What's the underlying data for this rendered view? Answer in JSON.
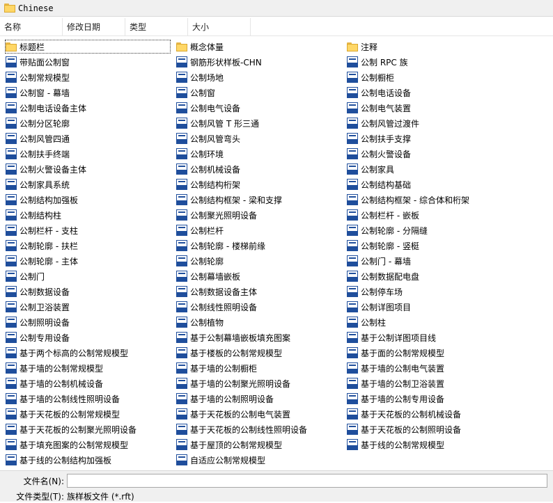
{
  "titlebar": {
    "path": "Chinese"
  },
  "columns": [
    "名称",
    "修改日期",
    "类型",
    "大小"
  ],
  "files": {
    "col1": [
      {
        "name": "标题栏",
        "type": "folder",
        "selected": true
      },
      {
        "name": "带贴面公制窗",
        "type": "rft"
      },
      {
        "name": "公制常规模型",
        "type": "rft"
      },
      {
        "name": "公制窗 - 幕墙",
        "type": "rft"
      },
      {
        "name": "公制电话设备主体",
        "type": "rft"
      },
      {
        "name": "公制分区轮廓",
        "type": "rft"
      },
      {
        "name": "公制风管四通",
        "type": "rft"
      },
      {
        "name": "公制扶手终端",
        "type": "rft"
      },
      {
        "name": "公制火警设备主体",
        "type": "rft"
      },
      {
        "name": "公制家具系统",
        "type": "rft"
      },
      {
        "name": "公制结构加强板",
        "type": "rft"
      },
      {
        "name": "公制结构柱",
        "type": "rft"
      },
      {
        "name": "公制栏杆 - 支柱",
        "type": "rft"
      },
      {
        "name": "公制轮廓 - 扶栏",
        "type": "rft"
      },
      {
        "name": "公制轮廓 - 主体",
        "type": "rft"
      },
      {
        "name": "公制门",
        "type": "rft"
      },
      {
        "name": "公制数据设备",
        "type": "rft"
      },
      {
        "name": "公制卫浴装置",
        "type": "rft"
      },
      {
        "name": "公制照明设备",
        "type": "rft"
      },
      {
        "name": "公制专用设备",
        "type": "rft"
      },
      {
        "name": "基于两个标高的公制常规模型",
        "type": "rft"
      },
      {
        "name": "基于墙的公制常规模型",
        "type": "rft"
      },
      {
        "name": "基于墙的公制机械设备",
        "type": "rft"
      },
      {
        "name": "基于墙的公制线性照明设备",
        "type": "rft"
      },
      {
        "name": "基于天花板的公制常规模型",
        "type": "rft"
      },
      {
        "name": "基于天花板的公制聚光照明设备",
        "type": "rft"
      },
      {
        "name": "基于填充图案的公制常规模型",
        "type": "rft"
      },
      {
        "name": "基于线的公制结构加强板",
        "type": "rft"
      }
    ],
    "col2": [
      {
        "name": "概念体量",
        "type": "folder"
      },
      {
        "name": "钢筋形状样板-CHN",
        "type": "rft"
      },
      {
        "name": "公制场地",
        "type": "rft"
      },
      {
        "name": "公制窗",
        "type": "rft"
      },
      {
        "name": "公制电气设备",
        "type": "rft"
      },
      {
        "name": "公制风管 T 形三通",
        "type": "rft"
      },
      {
        "name": "公制风管弯头",
        "type": "rft"
      },
      {
        "name": "公制环境",
        "type": "rft"
      },
      {
        "name": "公制机械设备",
        "type": "rft"
      },
      {
        "name": "公制结构桁架",
        "type": "rft"
      },
      {
        "name": "公制结构框架 - 梁和支撑",
        "type": "rft"
      },
      {
        "name": "公制聚光照明设备",
        "type": "rft"
      },
      {
        "name": "公制栏杆",
        "type": "rft"
      },
      {
        "name": "公制轮廓 - 楼梯前缘",
        "type": "rft"
      },
      {
        "name": "公制轮廓",
        "type": "rft"
      },
      {
        "name": "公制幕墙嵌板",
        "type": "rft"
      },
      {
        "name": "公制数据设备主体",
        "type": "rft"
      },
      {
        "name": "公制线性照明设备",
        "type": "rft"
      },
      {
        "name": "公制植物",
        "type": "rft"
      },
      {
        "name": "基于公制幕墙嵌板填充图案",
        "type": "rft"
      },
      {
        "name": "基于楼板的公制常规模型",
        "type": "rft"
      },
      {
        "name": "基于墙的公制橱柜",
        "type": "rft"
      },
      {
        "name": "基于墙的公制聚光照明设备",
        "type": "rft"
      },
      {
        "name": "基于墙的公制照明设备",
        "type": "rft"
      },
      {
        "name": "基于天花板的公制电气装置",
        "type": "rft"
      },
      {
        "name": "基于天花板的公制线性照明设备",
        "type": "rft"
      },
      {
        "name": "基于屋顶的公制常规模型",
        "type": "rft"
      },
      {
        "name": "自适应公制常规模型",
        "type": "rft"
      }
    ],
    "col3": [
      {
        "name": "注释",
        "type": "folder"
      },
      {
        "name": "公制 RPC 族",
        "type": "rft"
      },
      {
        "name": "公制橱柜",
        "type": "rft"
      },
      {
        "name": "公制电话设备",
        "type": "rft"
      },
      {
        "name": "公制电气装置",
        "type": "rft"
      },
      {
        "name": "公制风管过渡件",
        "type": "rft"
      },
      {
        "name": "公制扶手支撑",
        "type": "rft"
      },
      {
        "name": "公制火警设备",
        "type": "rft"
      },
      {
        "name": "公制家具",
        "type": "rft"
      },
      {
        "name": "公制结构基础",
        "type": "rft"
      },
      {
        "name": "公制结构框架 - 综合体和桁架",
        "type": "rft"
      },
      {
        "name": "公制栏杆 - 嵌板",
        "type": "rft"
      },
      {
        "name": "公制轮廓 - 分隔缝",
        "type": "rft"
      },
      {
        "name": "公制轮廓 - 竖梃",
        "type": "rft"
      },
      {
        "name": "公制门 - 幕墙",
        "type": "rft"
      },
      {
        "name": "公制数据配电盘",
        "type": "rft"
      },
      {
        "name": "公制停车场",
        "type": "rft"
      },
      {
        "name": "公制详图项目",
        "type": "rft"
      },
      {
        "name": "公制柱",
        "type": "rft"
      },
      {
        "name": "基于公制详图项目线",
        "type": "rft"
      },
      {
        "name": "基于面的公制常规模型",
        "type": "rft"
      },
      {
        "name": "基于墙的公制电气装置",
        "type": "rft"
      },
      {
        "name": "基于墙的公制卫浴装置",
        "type": "rft"
      },
      {
        "name": "基于墙的公制专用设备",
        "type": "rft"
      },
      {
        "name": "基于天花板的公制机械设备",
        "type": "rft"
      },
      {
        "name": "基于天花板的公制照明设备",
        "type": "rft"
      },
      {
        "name": "基于线的公制常规模型",
        "type": "rft"
      }
    ]
  },
  "footer": {
    "filename_label": "文件名(N):",
    "filename_value": "",
    "filetype_label": "文件类型(T):",
    "filetype_value": "族样板文件 (*.rft)"
  }
}
